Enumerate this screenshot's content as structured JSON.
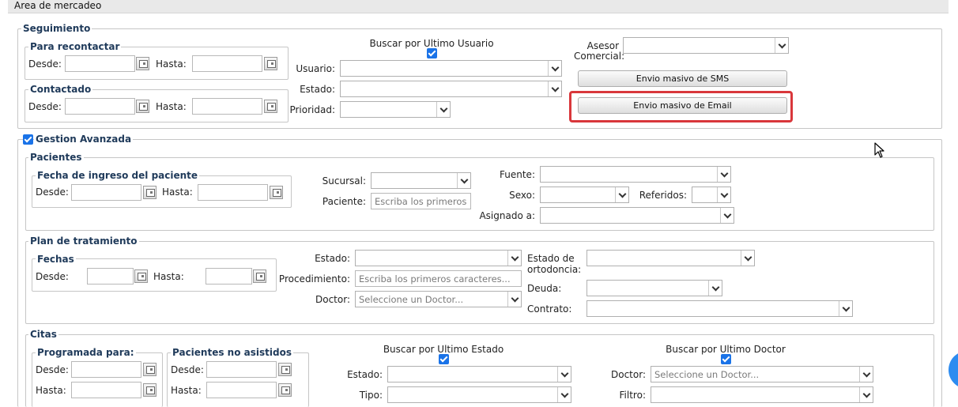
{
  "header": {
    "title": "Area de mercadeo"
  },
  "seguimiento": {
    "legend": "Seguimiento",
    "para_recontactar": {
      "legend": "Para recontactar",
      "desde": "Desde:",
      "hasta": "Hasta:"
    },
    "contactado": {
      "legend": "Contactado",
      "desde": "Desde:",
      "hasta": "Hasta:"
    },
    "buscar_ultimo_usuario": "Buscar por Ultimo Usuario",
    "usuario": "Usuario:",
    "estado": "Estado:",
    "prioridad": "Prioridad:",
    "asesor": "Asesor",
    "comercial": "Comercial:",
    "sms_button": "Envio masivo de SMS",
    "email_button": "Envio masivo de Email"
  },
  "gestion": {
    "legend": "Gestion Avanzada",
    "pacientes": {
      "legend": "Pacientes",
      "fecha_ingreso": {
        "legend": "Fecha de ingreso del paciente",
        "desde": "Desde:",
        "hasta": "Hasta:"
      },
      "sucursal": "Sucursal:",
      "paciente": "Paciente:",
      "paciente_placeholder": "Escriba los primeros caracteres...",
      "fuente": "Fuente:",
      "sexo": "Sexo:",
      "referidos": "Referidos:",
      "asignado": "Asignado a:"
    },
    "plan": {
      "legend": "Plan de tratamiento",
      "fechas": {
        "legend": "Fechas",
        "desde": "Desde:",
        "hasta": "Hasta:"
      },
      "estado": "Estado:",
      "procedimiento": "Procedimiento:",
      "procedimiento_placeholder": "Escriba los primeros caracteres...",
      "doctor": "Doctor:",
      "doctor_placeholder": "Seleccione un Doctor...",
      "estado_ortodoncia_1": "Estado de",
      "estado_ortodoncia_2": "ortodoncia:",
      "deuda": "Deuda:",
      "contrato": "Contrato:"
    },
    "citas": {
      "legend": "Citas",
      "programada": {
        "legend": "Programada para:",
        "desde": "Desde:",
        "hasta": "Hasta:"
      },
      "no_asistidos": {
        "legend": "Pacientes no asistidos",
        "desde": "Desde:",
        "hasta": "Hasta:"
      },
      "buscar_ultimo_estado": "Buscar por Ultimo Estado",
      "estado": "Estado:",
      "tipo": "Tipo:",
      "buscar_ultimo_doctor": "Buscar por Ultimo Doctor",
      "doctor": "Doctor:",
      "doctor_placeholder": "Seleccione un Doctor...",
      "filtro": "Filtro:"
    }
  },
  "colors": {
    "accent": "#1a73e8",
    "highlight": "#d9373b",
    "legend": "#1f3a5a"
  }
}
